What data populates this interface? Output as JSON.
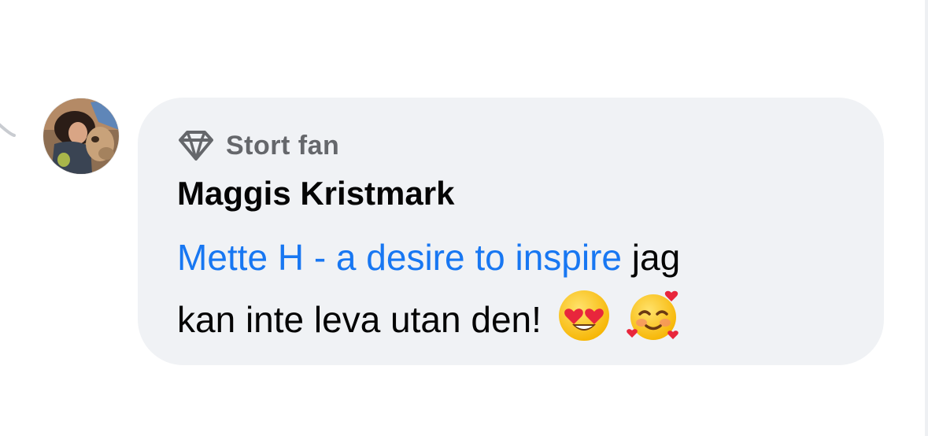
{
  "comment": {
    "badge": {
      "label": "Stort fan",
      "icon": "diamond-icon"
    },
    "author": "Maggis Kristmark",
    "mention": "Mette H - a desire to inspire",
    "body_line1": " jag",
    "body_line2": "kan inte leva utan den!",
    "emojis": [
      "heart-eyes-emoji",
      "smiling-face-with-hearts-emoji"
    ]
  },
  "colors": {
    "bubble_background": "#f0f2f5",
    "mention": "#1877f2",
    "badge_text": "#65676b",
    "text": "#050505"
  }
}
